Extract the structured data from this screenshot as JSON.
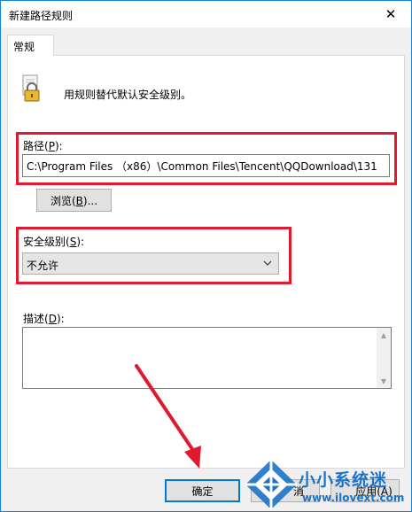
{
  "window": {
    "title": "新建路径规则",
    "close_glyph": "✕"
  },
  "tabs": [
    {
      "label": "常规"
    }
  ],
  "description": "用规则替代默认安全级别。",
  "path": {
    "label_pre": "路径(",
    "label_key": "P",
    "label_post": "):",
    "value": "C:\\Program Files （x86）\\Common Files\\Tencent\\QQDownload\\131"
  },
  "browse": {
    "label_pre": "浏览(",
    "label_key": "B",
    "label_post": ")..."
  },
  "security_level": {
    "label_pre": "安全级别(",
    "label_key": "S",
    "label_post": "):",
    "selected": "不允许"
  },
  "desc_field": {
    "label_pre": "描述(",
    "label_key": "D",
    "label_post": "):",
    "value": ""
  },
  "buttons": {
    "ok": "确定",
    "cancel_partial": "消",
    "apply_partial": "应用(A)"
  },
  "watermark": {
    "text_cn": "小小系统迷",
    "url": "www.ilovext.com"
  },
  "colors": {
    "highlight": "#e0192f",
    "accent": "#1883d7",
    "watermark": "#1a73c9"
  },
  "icons": [
    "close-icon",
    "lock-icon",
    "chevron-down-icon",
    "arrow-annotation-icon",
    "watermark-logo-icon"
  ]
}
